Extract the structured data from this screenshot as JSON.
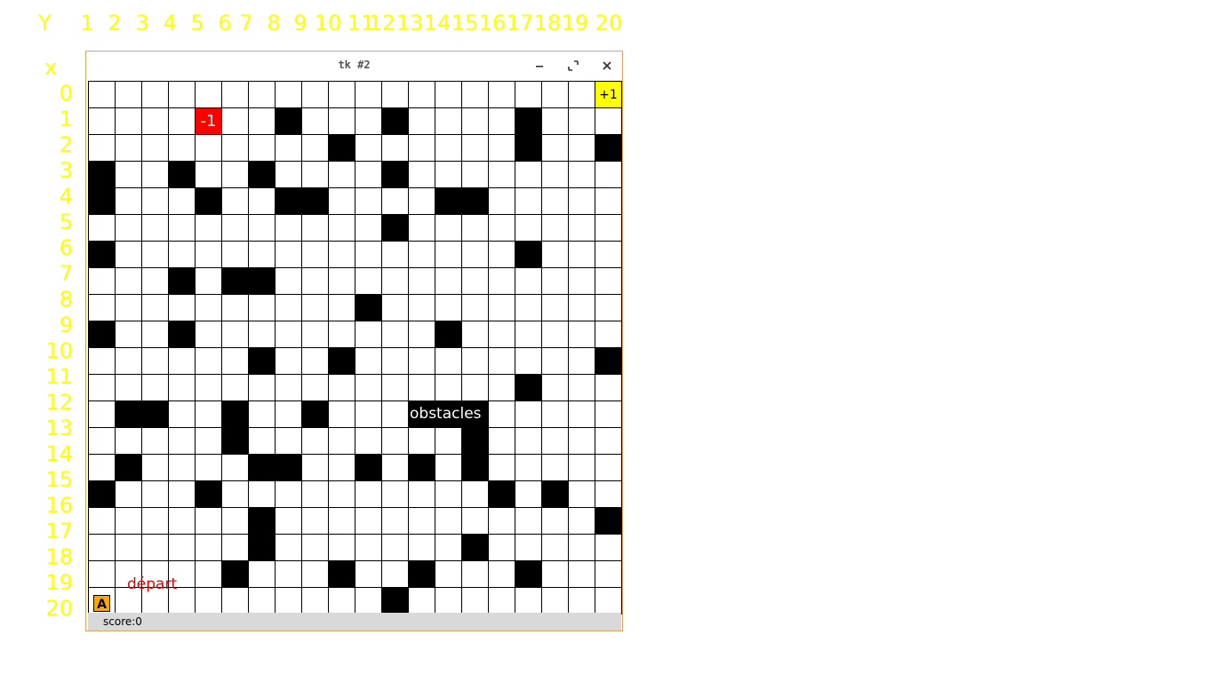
{
  "axis": {
    "y_label": "Y",
    "x_label": "x",
    "columns": [
      "1",
      "2",
      "3",
      "4",
      "5",
      "6",
      "7",
      "8",
      "9",
      "10",
      "11",
      "12",
      "13",
      "14",
      "15",
      "16",
      "17",
      "18",
      "19",
      "20"
    ],
    "rows": [
      "0",
      "1",
      "2",
      "3",
      "4",
      "5",
      "6",
      "7",
      "8",
      "9",
      "10",
      "11",
      "12",
      "13",
      "14",
      "15",
      "16",
      "17",
      "18",
      "19",
      "20"
    ]
  },
  "window": {
    "title": "tk #2",
    "minimize_icon": "minimize-icon",
    "maximize_icon": "maximize-icon",
    "close_icon": "close-icon"
  },
  "grid": {
    "rows": 20,
    "cols": 20,
    "obstacles": [
      [
        1,
        7
      ],
      [
        1,
        11
      ],
      [
        1,
        16
      ],
      [
        2,
        9
      ],
      [
        2,
        16
      ],
      [
        2,
        19
      ],
      [
        3,
        0
      ],
      [
        3,
        3
      ],
      [
        3,
        6
      ],
      [
        3,
        11
      ],
      [
        4,
        0
      ],
      [
        4,
        4
      ],
      [
        4,
        7
      ],
      [
        4,
        8
      ],
      [
        4,
        13
      ],
      [
        4,
        14
      ],
      [
        5,
        11
      ],
      [
        6,
        0
      ],
      [
        6,
        16
      ],
      [
        7,
        3
      ],
      [
        7,
        5
      ],
      [
        7,
        6
      ],
      [
        8,
        10
      ],
      [
        9,
        0
      ],
      [
        9,
        3
      ],
      [
        9,
        13
      ],
      [
        10,
        6
      ],
      [
        10,
        9
      ],
      [
        10,
        19
      ],
      [
        11,
        16
      ],
      [
        12,
        1
      ],
      [
        12,
        2
      ],
      [
        12,
        5
      ],
      [
        12,
        8
      ],
      [
        12,
        12
      ],
      [
        12,
        13
      ],
      [
        12,
        14
      ],
      [
        13,
        5
      ],
      [
        13,
        14
      ],
      [
        14,
        1
      ],
      [
        14,
        6
      ],
      [
        14,
        7
      ],
      [
        14,
        10
      ],
      [
        14,
        12
      ],
      [
        14,
        14
      ],
      [
        15,
        0
      ],
      [
        15,
        4
      ],
      [
        15,
        15
      ],
      [
        15,
        17
      ],
      [
        16,
        6
      ],
      [
        16,
        19
      ],
      [
        17,
        6
      ],
      [
        17,
        14
      ],
      [
        18,
        5
      ],
      [
        18,
        9
      ],
      [
        18,
        12
      ],
      [
        18,
        16
      ],
      [
        19,
        11
      ]
    ],
    "penalty": {
      "row": 1,
      "col": 4,
      "label": "-1"
    },
    "reward": {
      "row": 0,
      "col": 19,
      "label": "+1"
    },
    "agent": {
      "row": 19,
      "col": 0,
      "label": "A"
    }
  },
  "annotations": {
    "start": "départ",
    "obstacles": "obstacles"
  },
  "colors": {
    "axis": "#ffff00",
    "penalty": "#ff0000",
    "reward": "#ffff00",
    "agent": "#ffa500",
    "start_text": "#e00000"
  },
  "status": {
    "score": "score:0"
  }
}
